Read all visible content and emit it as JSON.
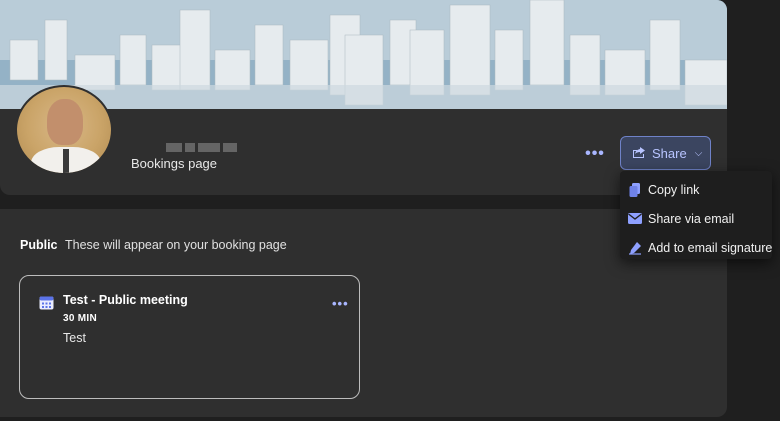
{
  "header": {
    "page_subtitle": "Bookings page",
    "more_label": "•••",
    "share_label": "Share",
    "chevron": "⌵"
  },
  "share_menu": {
    "items": [
      {
        "label": "Copy link",
        "icon": "copy-icon"
      },
      {
        "label": "Share via email",
        "icon": "mail-icon"
      },
      {
        "label": "Add to email signature",
        "icon": "signature-icon"
      }
    ]
  },
  "section": {
    "label": "Public",
    "description": "These will appear on your booking page"
  },
  "meeting": {
    "title": "Test - Public meeting",
    "duration": "30 MIN",
    "description": "Test",
    "more_label": "•••"
  },
  "colors": {
    "accent": "#a9b6ff",
    "card_bg": "#2f2f2f",
    "page_bg": "#1f1f1f"
  }
}
